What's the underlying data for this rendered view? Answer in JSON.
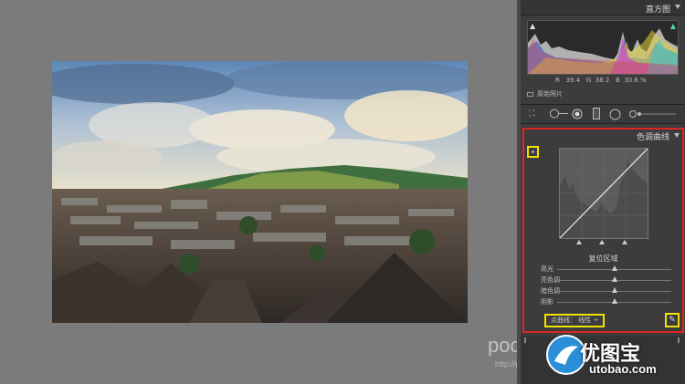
{
  "watermark": {
    "text": "poco",
    "subtext": "http://photo"
  },
  "histogram": {
    "title": "直方图",
    "readout": {
      "r_label": "R",
      "r_value": "39.4",
      "g_label": "G",
      "g_value": "38.2",
      "b_label": "B",
      "b_value": "30.6",
      "unit": "%"
    },
    "original_photo_label": "原始照片"
  },
  "tone_curve": {
    "title": "色调曲线",
    "region_title": "复位区域",
    "sliders": [
      {
        "label": "高光",
        "value": 0.5
      },
      {
        "label": "亮色调",
        "value": 0.5
      },
      {
        "label": "暗色调",
        "value": 0.5
      },
      {
        "label": "阴影",
        "value": 0.5
      }
    ],
    "point_curve_label": "点曲线：",
    "point_curve_value": "线性",
    "point_curve_arrows": "÷"
  },
  "branding": {
    "name": "优图宝",
    "url": "utobao.com"
  },
  "icons": [
    "target-adjust-icon",
    "pencil-icon",
    "crop-icon",
    "spot-removal-icon",
    "red-eye-icon",
    "graduated-filter-icon",
    "radial-filter-icon",
    "brush-icon"
  ]
}
